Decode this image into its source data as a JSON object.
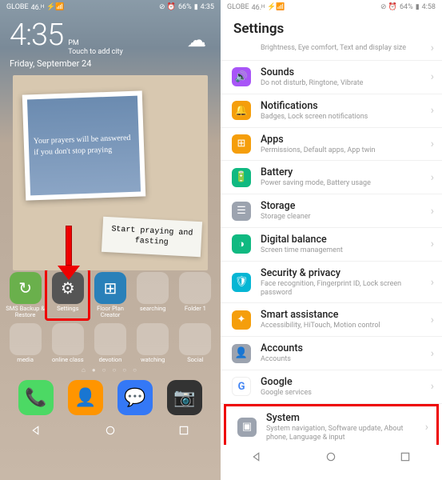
{
  "left": {
    "status": {
      "carrier": "GLOBE",
      "signal": "46.ᴴ",
      "icons": "⚡📶",
      "alarm": "⊘ ⏰",
      "battery": "66%",
      "time": "4:35"
    },
    "clock": {
      "time": "4:35",
      "ampm": "PM",
      "hint": "Touch to add city",
      "date": "Friday, September 24"
    },
    "polaroid": "Your prayers will be answered if you don't stop praying",
    "note": "Start praying and fasting",
    "row1": [
      {
        "label": "SMS Backup & Restore",
        "bg": "#6ab04c",
        "glyph": "↻"
      },
      {
        "label": "Settings",
        "bg": "#555",
        "glyph": "⚙"
      },
      {
        "label": "Floor Plan Creator",
        "bg": "#2980b9",
        "glyph": "⊞"
      },
      {
        "label": "searching",
        "folder": true
      },
      {
        "label": "Folder 1",
        "folder": true
      }
    ],
    "row2": [
      {
        "label": "media",
        "folder": true
      },
      {
        "label": "online class",
        "folder": true
      },
      {
        "label": "devotion",
        "folder": true
      },
      {
        "label": "watching",
        "folder": true
      },
      {
        "label": "Social",
        "folder": true
      }
    ],
    "dock": [
      {
        "bg": "#4cd964",
        "glyph": "📞"
      },
      {
        "bg": "#ff9500",
        "glyph": "👤"
      },
      {
        "bg": "#3478f6",
        "glyph": "💬"
      },
      {
        "bg": "#333",
        "glyph": "📷"
      }
    ]
  },
  "right": {
    "status": {
      "carrier": "GLOBE",
      "signal": "46.ᴴ",
      "icons": "⚡📶",
      "alarm": "⊘ ⏰",
      "battery": "64%",
      "time": "4:58"
    },
    "title": "Settings",
    "cut": "Brightness, Eye comfort, Text and display size",
    "items": [
      {
        "label": "Sounds",
        "desc": "Do not disturb, Ringtone, Vibrate",
        "bg": "#a855f7",
        "glyph": "🔊"
      },
      {
        "label": "Notifications",
        "desc": "Badges, Lock screen notifications",
        "bg": "#f59e0b",
        "glyph": "🔔"
      },
      {
        "label": "Apps",
        "desc": "Permissions, Default apps, App twin",
        "bg": "#f59e0b",
        "glyph": "⊞"
      },
      {
        "label": "Battery",
        "desc": "Power saving mode, Battery usage",
        "bg": "#10b981",
        "glyph": "🔋"
      },
      {
        "label": "Storage",
        "desc": "Storage cleaner",
        "bg": "#9ca3af",
        "glyph": "☰"
      },
      {
        "label": "Digital balance",
        "desc": "Screen time management",
        "bg": "#10b981",
        "glyph": "◑"
      },
      {
        "label": "Security & privacy",
        "desc": "Face recognition, Fingerprint ID, Lock screen password",
        "bg": "#06b6d4",
        "glyph": "🛡"
      },
      {
        "label": "Smart assistance",
        "desc": "Accessibility, HiTouch, Motion control",
        "bg": "#f59e0b",
        "glyph": "✦"
      },
      {
        "label": "Accounts",
        "desc": "Accounts",
        "bg": "#9ca3af",
        "glyph": "👤"
      },
      {
        "label": "Google",
        "desc": "Google services",
        "bg": "#fff",
        "glyph": "G"
      },
      {
        "label": "System",
        "desc": "System navigation, Software update, About phone, Language & input",
        "bg": "#9ca3af",
        "glyph": "▣"
      }
    ]
  }
}
